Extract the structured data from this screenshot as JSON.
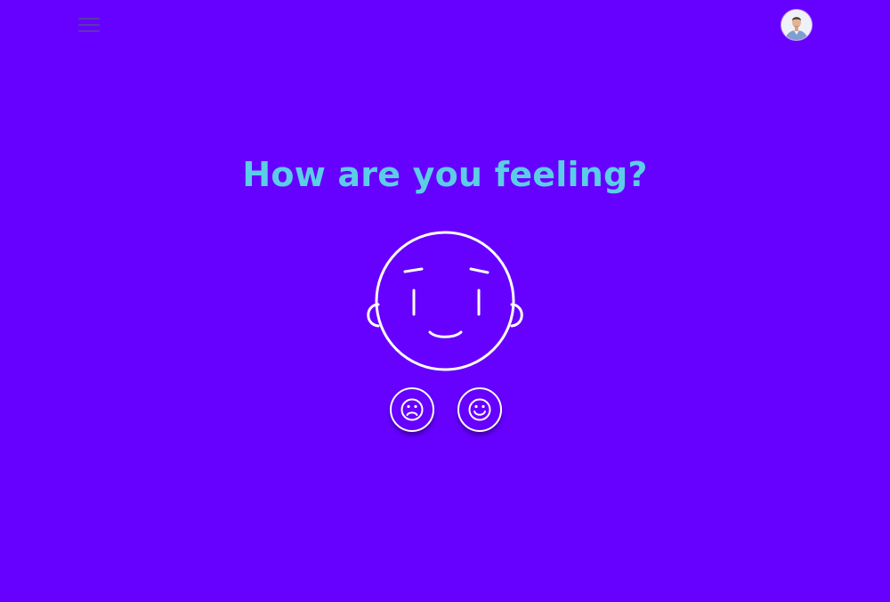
{
  "header": {
    "menu_icon": "hamburger-menu-icon",
    "avatar_icon": "user-avatar"
  },
  "main": {
    "title": "How are you feeling?",
    "face_icon": "neutral-face-illustration",
    "buttons": [
      {
        "icon": "sad-face-icon"
      },
      {
        "icon": "happy-face-icon"
      }
    ]
  },
  "colors": {
    "background": "#6600ff",
    "title": "#5ccde8",
    "lines": "#ffffff"
  }
}
